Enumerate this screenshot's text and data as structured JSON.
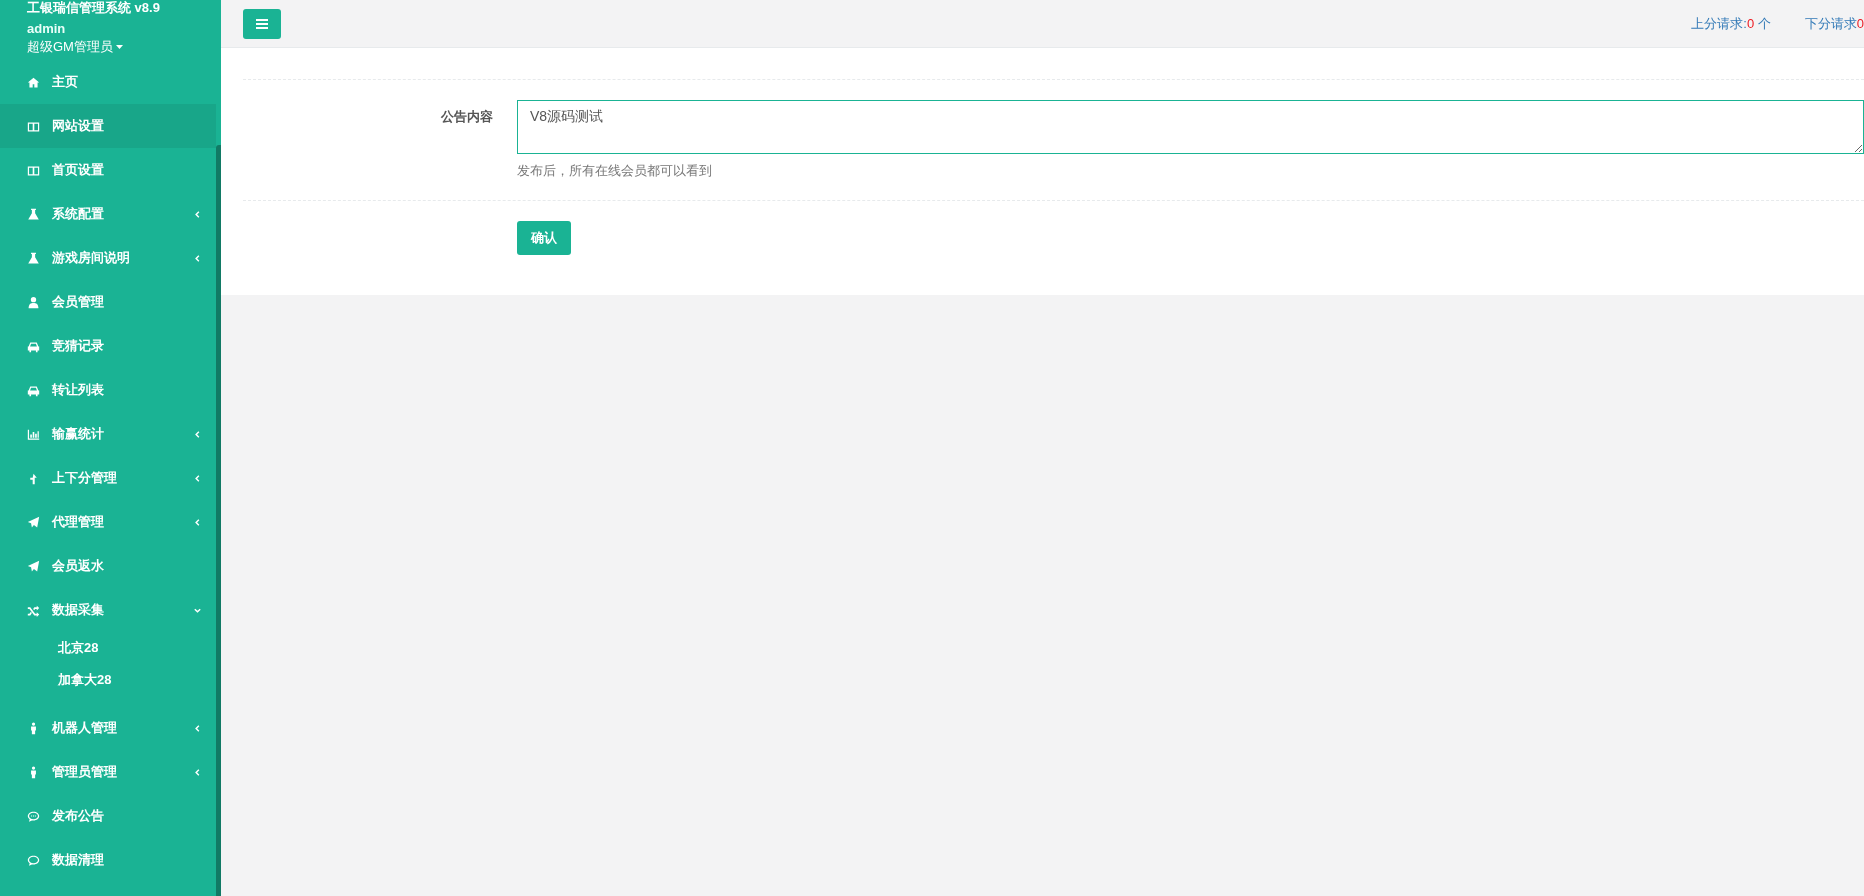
{
  "sidebar": {
    "title": "工银瑞信管理系统 v8.9",
    "user": "admin",
    "role": "超级GM管理员",
    "items": [
      {
        "label": "主页",
        "kind": "link",
        "selected": false
      },
      {
        "label": "网站设置",
        "kind": "link",
        "selected": true
      },
      {
        "label": "首页设置",
        "kind": "link",
        "selected": false
      },
      {
        "label": "系统配置",
        "kind": "menu",
        "selected": false,
        "expanded": false
      },
      {
        "label": "游戏房间说明",
        "kind": "menu",
        "selected": false,
        "expanded": false
      },
      {
        "label": "会员管理",
        "kind": "link",
        "selected": false
      },
      {
        "label": "竞猜记录",
        "kind": "link",
        "selected": false
      },
      {
        "label": "转让列表",
        "kind": "link",
        "selected": false
      },
      {
        "label": "输赢统计",
        "kind": "menu",
        "selected": false,
        "expanded": false
      },
      {
        "label": "上下分管理",
        "kind": "menu",
        "selected": false,
        "expanded": false
      },
      {
        "label": "代理管理",
        "kind": "menu",
        "selected": false,
        "expanded": false
      },
      {
        "label": "会员返水",
        "kind": "link",
        "selected": false
      },
      {
        "label": "数据采集",
        "kind": "menu",
        "selected": false,
        "expanded": true,
        "children": [
          {
            "label": "北京28",
            "selected": false
          },
          {
            "label": "加拿大28",
            "selected": false
          }
        ]
      },
      {
        "label": "机器人管理",
        "kind": "menu",
        "selected": false,
        "expanded": false
      },
      {
        "label": "管理员管理",
        "kind": "menu",
        "selected": false,
        "expanded": false
      },
      {
        "label": "发布公告",
        "kind": "link",
        "selected": false
      },
      {
        "label": "数据清理",
        "kind": "link",
        "selected": false
      }
    ]
  },
  "top_bar": {
    "requests": [
      {
        "label": "上分请求:",
        "count": "0",
        "unit": "个"
      },
      {
        "label": "下分请求",
        "count": "0"
      }
    ]
  },
  "form": {
    "label": "公告内容",
    "value": "V8源码测试",
    "help": "发布后，所有在线会员都可以看到",
    "submit": "确认"
  }
}
